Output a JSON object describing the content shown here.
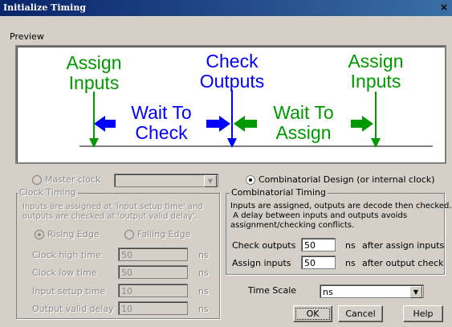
{
  "window": {
    "title": "Initialize Timing",
    "close": "×"
  },
  "preview": {
    "label": "Preview",
    "assign_inputs_1": [
      "Assign",
      "Inputs"
    ],
    "check_outputs": [
      "Check",
      "Outputs"
    ],
    "assign_inputs_2": [
      "Assign",
      "Inputs"
    ],
    "wait_to_check": [
      "Wait To",
      "Check"
    ],
    "wait_to_assign": [
      "Wait To",
      "Assign"
    ]
  },
  "mode": {
    "master_clock": "Master clock",
    "combinatorial": "Combinatorial Design (or internal clock)",
    "selected": "combinatorial"
  },
  "clock_timing": {
    "title": "Clock Timing",
    "desc": [
      "Inputs are assigned at 'input setup time' and",
      "outputs are checked at 'output valid delay'."
    ],
    "rising_edge": "Rising Edge",
    "falling_edge": "Falling Edge",
    "rows": [
      {
        "label": "Clock high time",
        "value": "50",
        "unit": "ns"
      },
      {
        "label": "Clock low time",
        "value": "50",
        "unit": "ns"
      },
      {
        "label": "Input setup time",
        "value": "10",
        "unit": "ns"
      },
      {
        "label": "Output valid delay",
        "value": "10",
        "unit": "ns"
      }
    ]
  },
  "comb_timing": {
    "title": "Combinatorial Timing",
    "desc": [
      "Inputs are assigned, outputs are decode then checked.",
      " A delay between inputs and outputs avoids",
      "assignment/checking conflicts."
    ],
    "check_outputs": {
      "label": "Check outputs",
      "value": "50",
      "unit": "ns",
      "suffix": "after assign inputs"
    },
    "assign_inputs": {
      "label": "Assign inputs",
      "value": "50",
      "unit": "ns",
      "suffix": "after output check"
    }
  },
  "time_scale": {
    "label": "Time Scale",
    "value": "ns"
  },
  "buttons": {
    "ok": "OK",
    "cancel": "Cancel",
    "help": "Help"
  },
  "colors": {
    "arrow_green": "#009900",
    "arrow_blue": "#0000ff"
  }
}
